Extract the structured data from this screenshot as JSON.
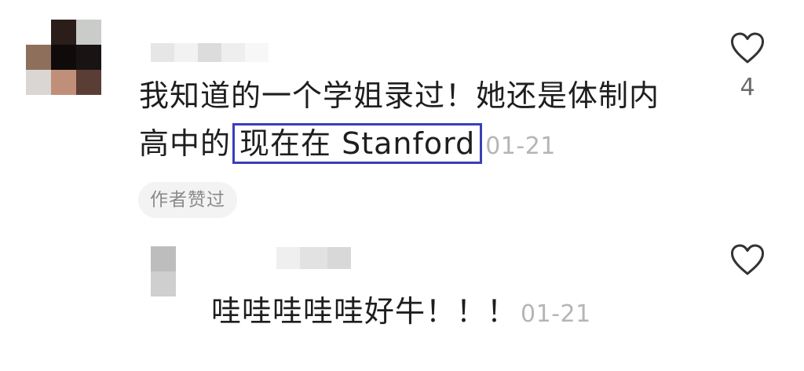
{
  "main_comment": {
    "text_line1": "我知道的一个学姐录过！她还是体制内",
    "text_line2_prefix": "高中的",
    "highlighted_text": "现在在 Stanford",
    "timestamp": "01-21",
    "author_liked_badge": "作者赞过",
    "like_count": "4",
    "like_icon": "heart-outline-icon"
  },
  "reply_comment": {
    "text": "哇哇哇哇哇好牛！！！",
    "timestamp": "01-21",
    "like_icon": "heart-outline-icon"
  },
  "colors": {
    "highlight_border": "#3a3fb8",
    "timestamp": "#b5b5b5",
    "badge_background": "#f3f3f3"
  }
}
